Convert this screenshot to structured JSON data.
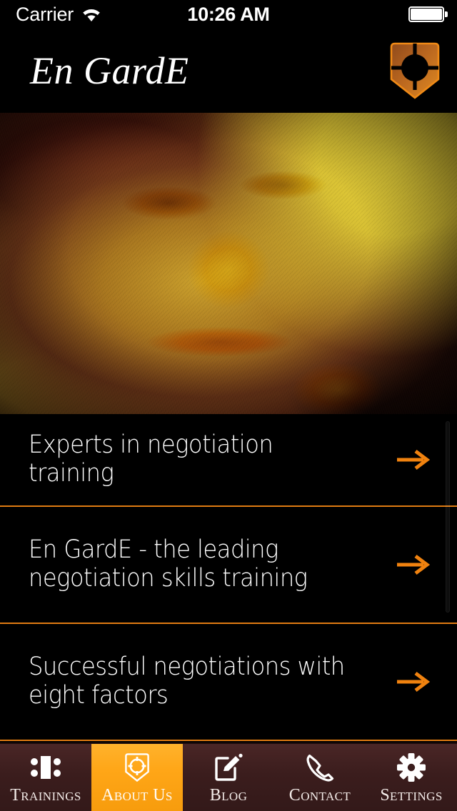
{
  "status_bar": {
    "carrier": "Carrier",
    "time": "10:26 AM",
    "wifi_icon": "wifi-icon",
    "battery_icon": "battery-full-icon"
  },
  "header": {
    "brand_title": "En GardE",
    "logo_icon": "en-garde-shield-logo"
  },
  "hero": {
    "alt": "duotone portrait of a man resting chin on hand"
  },
  "list": {
    "items": [
      {
        "title": "Experts in negotiation training",
        "arrow_icon": "arrow-right-icon"
      },
      {
        "title": "En GardE - the leading negotiation skills training",
        "arrow_icon": "arrow-right-icon"
      },
      {
        "title": "Successful negotiations with eight factors",
        "arrow_icon": "arrow-right-icon"
      }
    ]
  },
  "tabbar": {
    "active_index": 1,
    "items": [
      {
        "label": "Trainings",
        "icon": "meeting-table-icon"
      },
      {
        "label": "About Us",
        "icon": "shield-logo-icon"
      },
      {
        "label": "Blog",
        "icon": "compose-pencil-icon"
      },
      {
        "label": "Contact",
        "icon": "phone-handset-icon"
      },
      {
        "label": "Settings",
        "icon": "gear-icon"
      }
    ]
  },
  "colors": {
    "accent_orange": "#e07b12",
    "tab_active_orange": "#ffa617",
    "tabbar_maroon": "#3b1d1d",
    "background_black": "#000000",
    "text_white": "#ffffff"
  }
}
